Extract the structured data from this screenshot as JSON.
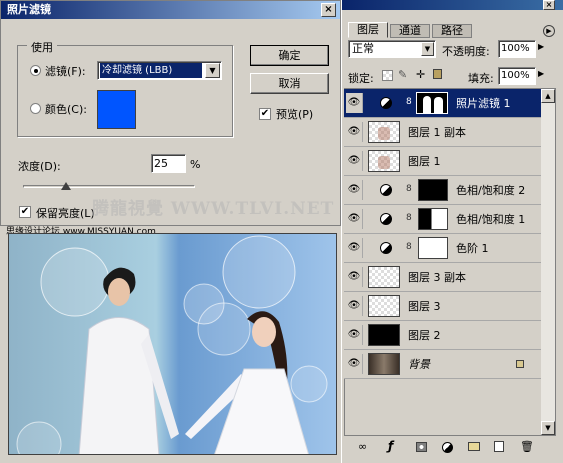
{
  "dialog": {
    "title": "照片滤镜",
    "close": "×",
    "use_group": "使用",
    "filter_label": "滤镜(F):",
    "filter_value": "冷却滤镜 (LBB)",
    "color_label": "颜色(C):",
    "ok": "确定",
    "cancel": "取消",
    "preview": "预览(P)",
    "density_label": "浓度(D):",
    "density_value": "25",
    "density_unit": "%",
    "preserve_luminosity": "保留亮度(L)",
    "colors": {
      "swatch": "#0055ff"
    }
  },
  "watermark": {
    "text": "腾龍視覺 WWW.TLVI.NET",
    "forum": "思缘设计论坛 www.MISSYUAN.com"
  },
  "panel": {
    "title_close": "×",
    "tabs": [
      "图层",
      "通道",
      "路径"
    ],
    "blend_mode": "正常",
    "opacity_label": "不透明度:",
    "opacity_value": "100%",
    "lock_label": "锁定:",
    "fill_label": "填充:",
    "fill_value": "100%",
    "layers": [
      {
        "name": "照片滤镜 1",
        "type": "adjustment",
        "mask": "photo",
        "selected": true
      },
      {
        "name": "图层 1 副本",
        "type": "photo"
      },
      {
        "name": "图层 1",
        "type": "photo"
      },
      {
        "name": "色相/饱和度 2",
        "type": "adjustment",
        "mask": "black"
      },
      {
        "name": "色相/饱和度 1",
        "type": "adjustment",
        "mask": "half"
      },
      {
        "name": "色阶 1",
        "type": "adjustment",
        "mask": "white"
      },
      {
        "name": "图层 3 副本",
        "type": "checker"
      },
      {
        "name": "图层 3",
        "type": "checker"
      },
      {
        "name": "图层 2",
        "type": "black"
      },
      {
        "name": "背景",
        "type": "photo",
        "locked": true
      }
    ]
  }
}
